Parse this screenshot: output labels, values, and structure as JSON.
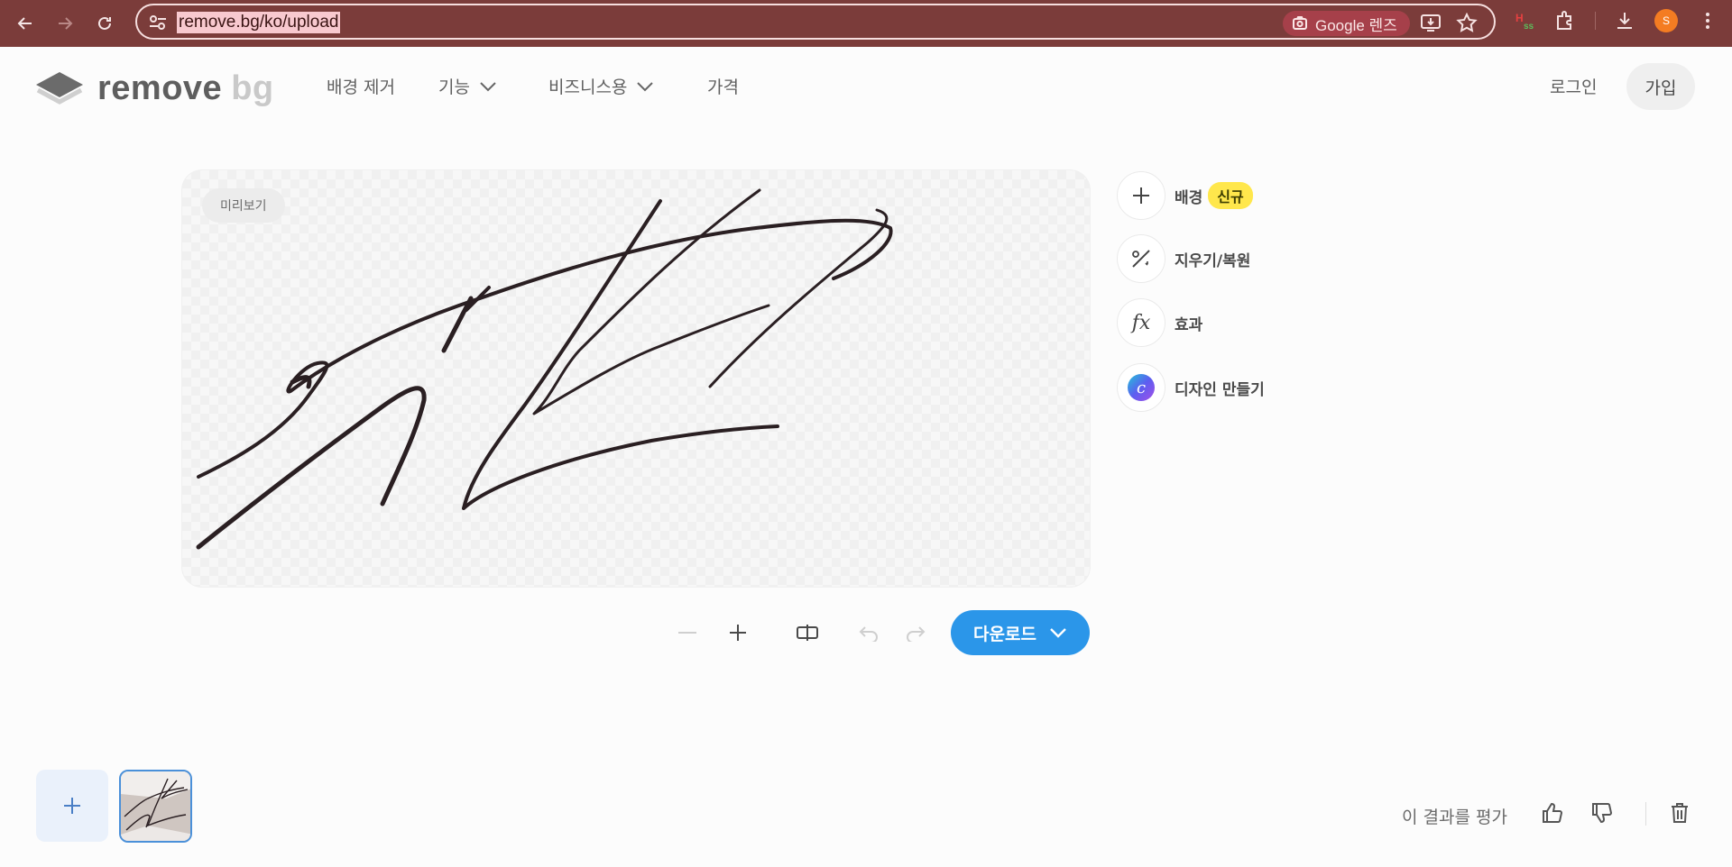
{
  "browser": {
    "url": "remove.bg/ko/upload",
    "lens_label": "Google 렌즈",
    "profile_initial": "S"
  },
  "header": {
    "logo_word": "remove",
    "logo_suffix": "bg",
    "nav": [
      {
        "label": "배경 제거"
      },
      {
        "label": "기능"
      },
      {
        "label": "비즈니스용"
      },
      {
        "label": "가격"
      }
    ],
    "login": "로그인",
    "signup": "가입"
  },
  "editor": {
    "preview_chip": "미리보기",
    "tools": [
      {
        "label": "배경",
        "badge": "신규",
        "icon": "plus-icon"
      },
      {
        "label": "지우기/복원",
        "icon": "magic-brush-icon"
      },
      {
        "label": "효과",
        "icon": "fx-icon"
      },
      {
        "label": "디자인 만들기",
        "icon": "canva-icon"
      }
    ],
    "download_label": "다운로드"
  },
  "footer": {
    "rate_label": "이 결과를 평가"
  },
  "colors": {
    "chrome": "#7b3c3a",
    "accent": "#2b96e9",
    "badge": "#ffe74c"
  }
}
